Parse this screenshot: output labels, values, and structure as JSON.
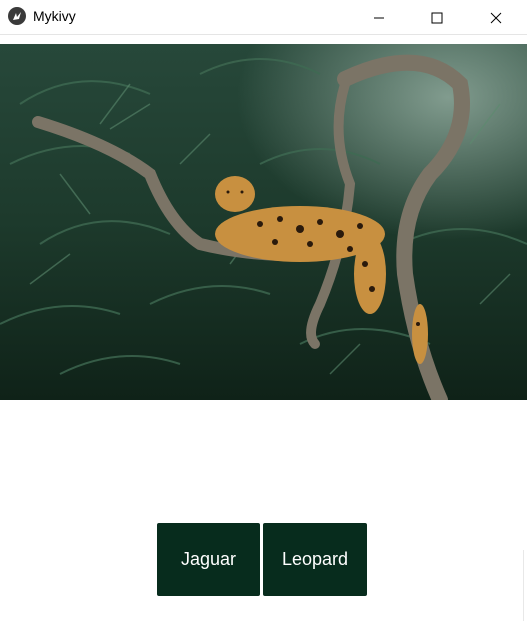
{
  "window": {
    "title": "Mykivy",
    "controls": [
      "minimize-icon",
      "maximize-icon",
      "close-icon"
    ]
  },
  "image": {
    "subject": "jaguar-on-branch"
  },
  "buttons": [
    {
      "label": "Jaguar"
    },
    {
      "label": "Leopard"
    }
  ],
  "colors": {
    "button_bg": "#072c1d",
    "button_text": "#ffffff"
  }
}
